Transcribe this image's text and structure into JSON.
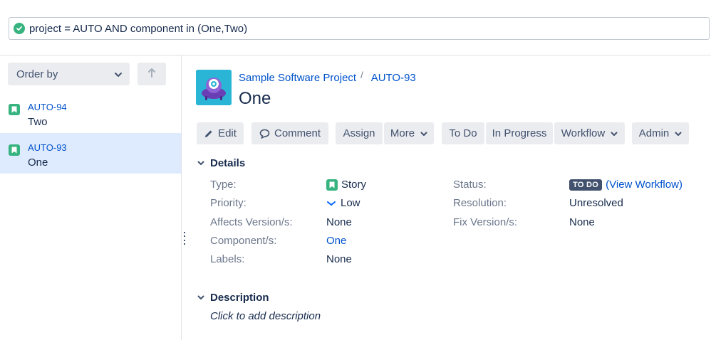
{
  "jql": {
    "query": "project = AUTO AND component in (One,Two)"
  },
  "left_panel": {
    "order_by_label": "Order by",
    "issues": [
      {
        "key": "AUTO-94",
        "summary": "Two"
      },
      {
        "key": "AUTO-93",
        "summary": "One"
      }
    ]
  },
  "issue": {
    "project": "Sample Software Project",
    "key": "AUTO-93",
    "title": "One"
  },
  "toolbar": {
    "edit": "Edit",
    "comment": "Comment",
    "assign": "Assign",
    "more": "More",
    "todo": "To Do",
    "in_progress": "In Progress",
    "workflow": "Workflow",
    "admin": "Admin"
  },
  "details": {
    "heading": "Details",
    "type_label": "Type:",
    "type_value": "Story",
    "priority_label": "Priority:",
    "priority_value": "Low",
    "affects_label": "Affects Version/s:",
    "affects_value": "None",
    "component_label": "Component/s:",
    "component_value": "One",
    "labels_label": "Labels:",
    "labels_value": "None",
    "status_label": "Status:",
    "status_lozenge": "TO DO",
    "status_link": "(View Workflow)",
    "resolution_label": "Resolution:",
    "resolution_value": "Unresolved",
    "fix_label": "Fix Version/s:",
    "fix_value": "None"
  },
  "description": {
    "heading": "Description",
    "placeholder": "Click to add description"
  },
  "colors": {
    "link": "#0052cc",
    "story": "#36b37e",
    "selected_row": "#deebff",
    "button_bg": "#ebecf0",
    "lozenge": "#42526e"
  }
}
